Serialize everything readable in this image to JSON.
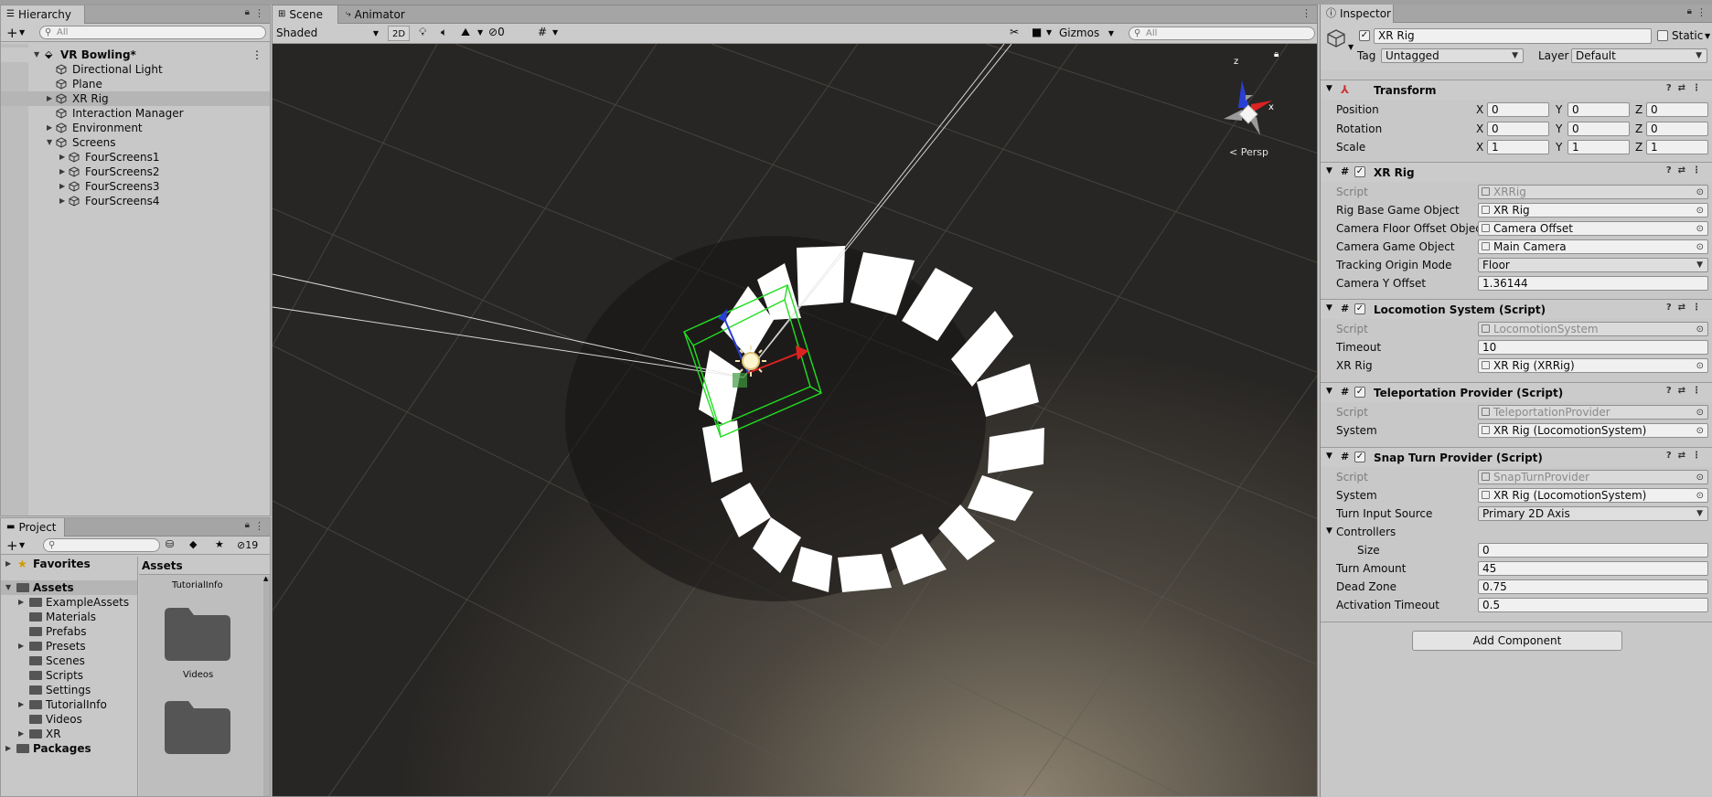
{
  "hierarchy": {
    "tab_label": "Hierarchy",
    "search_placeholder": "All",
    "items": [
      {
        "label": "VR Bowling*"
      },
      {
        "label": "Directional Light"
      },
      {
        "label": "Plane"
      },
      {
        "label": "XR Rig"
      },
      {
        "label": "Interaction Manager"
      },
      {
        "label": "Environment"
      },
      {
        "label": "Screens"
      },
      {
        "label": "FourScreens1"
      },
      {
        "label": "FourScreens2"
      },
      {
        "label": "FourScreens3"
      },
      {
        "label": "FourScreens4"
      }
    ]
  },
  "scene": {
    "tabs": [
      {
        "label": "Scene"
      },
      {
        "label": "Animator"
      }
    ],
    "shading": "Shaded",
    "mode_2d": "2D",
    "hidden_count": "0",
    "gizmos": "Gizmos",
    "search_placeholder": "All",
    "persp": "Persp",
    "axis_z": "z",
    "axis_x": "x"
  },
  "project": {
    "tab_label": "Project",
    "hidden_count": "19",
    "tree": [
      {
        "label": "Favorites"
      },
      {
        "label": "Assets"
      },
      {
        "label": "ExampleAssets"
      },
      {
        "label": "Materials"
      },
      {
        "label": "Prefabs"
      },
      {
        "label": "Presets"
      },
      {
        "label": "Scenes"
      },
      {
        "label": "Scripts"
      },
      {
        "label": "Settings"
      },
      {
        "label": "TutorialInfo"
      },
      {
        "label": "Videos"
      },
      {
        "label": "XR"
      },
      {
        "label": "Packages"
      }
    ],
    "assets_header": "Assets",
    "grid_items": [
      {
        "label": "TutorialInfo"
      },
      {
        "label": "Videos"
      }
    ]
  },
  "inspector": {
    "tab_label": "Inspector",
    "object_name": "XR Rig",
    "static_label": "Static",
    "tag_label": "Tag",
    "tag_value": "Untagged",
    "layer_label": "Layer",
    "layer_value": "Default",
    "transform": {
      "title": "Transform",
      "position_label": "Position",
      "position": [
        "0",
        "0",
        "0"
      ],
      "rotation_label": "Rotation",
      "rotation": [
        "0",
        "0",
        "0"
      ],
      "scale_label": "Scale",
      "scale": [
        "1",
        "1",
        "1"
      ],
      "axis_labels": [
        "X",
        "Y",
        "Z"
      ]
    },
    "xr_rig": {
      "title": "XR Rig",
      "script_label": "Script",
      "script": "XRRig",
      "rig_base_label": "Rig Base Game Object",
      "rig_base": "XR Rig",
      "floor_offset_label": "Camera Floor Offset Object",
      "floor_offset": "Camera Offset",
      "camera_label": "Camera Game Object",
      "camera": "Main Camera",
      "tracking_label": "Tracking Origin Mode",
      "tracking": "Floor",
      "y_offset_label": "Camera Y Offset",
      "y_offset": "1.36144"
    },
    "locomotion": {
      "title": "Locomotion System (Script)",
      "script_label": "Script",
      "script": "LocomotionSystem",
      "timeout_label": "Timeout",
      "timeout": "10",
      "xr_rig_label": "XR Rig",
      "xr_rig": "XR Rig (XRRig)"
    },
    "teleport": {
      "title": "Teleportation Provider (Script)",
      "script_label": "Script",
      "script": "TeleportationProvider",
      "system_label": "System",
      "system": "XR Rig (LocomotionSystem)"
    },
    "snap": {
      "title": "Snap Turn Provider (Script)",
      "script_label": "Script",
      "script": "SnapTurnProvider",
      "system_label": "System",
      "system": "XR Rig (LocomotionSystem)",
      "turn_input_label": "Turn Input Source",
      "turn_input": "Primary 2D Axis",
      "controllers_label": "Controllers",
      "size_label": "Size",
      "size": "0",
      "turn_amount_label": "Turn Amount",
      "turn_amount": "45",
      "dead_zone_label": "Dead Zone",
      "dead_zone": "0.75",
      "activation_label": "Activation Timeout",
      "activation": "0.5"
    },
    "add_component": "Add Component"
  },
  "colors": {
    "selection": "#b5b5b5",
    "scene_bg": "#2e2c28",
    "gizmo_green": "#22dd22"
  }
}
